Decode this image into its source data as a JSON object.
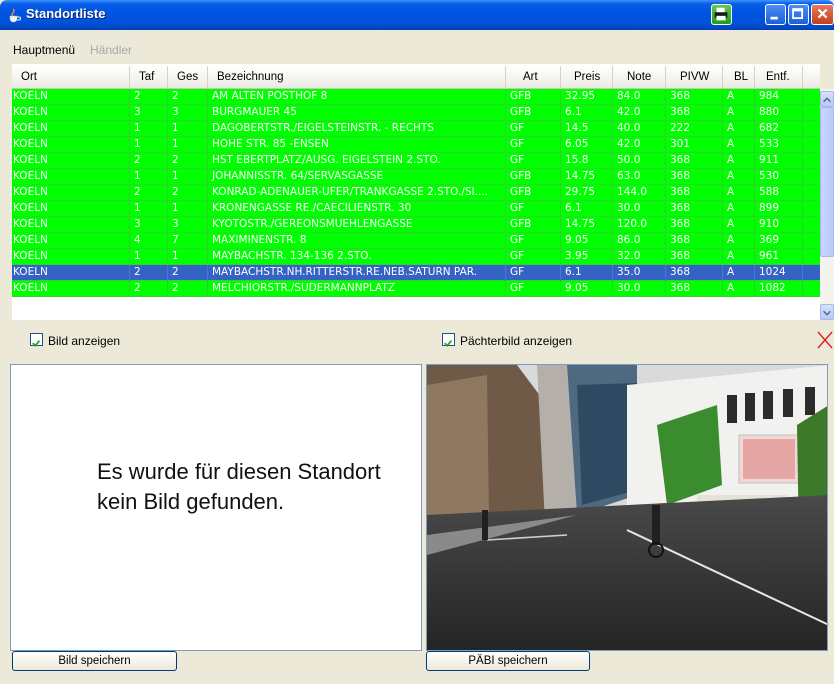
{
  "window": {
    "title": "Standortliste"
  },
  "menu": {
    "main": "Hauptmenü",
    "dealer": "Händler"
  },
  "table": {
    "columns": [
      "Ort",
      "Taf",
      "Ges",
      "Bezeichnung",
      "Art",
      "Preis",
      "Note",
      "PIVW",
      "BL",
      "Entf."
    ],
    "rows": [
      [
        "KOELN",
        "2",
        "2",
        "AM ALTEN POSTHOF 8",
        "GFB",
        "32.95",
        "84.0",
        "368",
        "A",
        "984"
      ],
      [
        "KOELN",
        "3",
        "3",
        "BURGMAUER 45",
        "GFB",
        "6.1",
        "42.0",
        "368",
        "A",
        "880"
      ],
      [
        "KOELN",
        "1",
        "1",
        "DAGOBERTSTR./EIGELSTEINSTR. - RECHTS",
        "GF",
        "14.5",
        "40.0",
        "222",
        "A",
        "682"
      ],
      [
        "KOELN",
        "1",
        "1",
        "HOHE STR. 85                    -ENSEN",
        "GF",
        "6.05",
        "42.0",
        "301",
        "A",
        "533"
      ],
      [
        "KOELN",
        "2",
        "2",
        "HST EBERTPLATZ/AUSG. EIGELSTEIN 2.STO.",
        "GF",
        "15.8",
        "50.0",
        "368",
        "A",
        "911"
      ],
      [
        "KOELN",
        "1",
        "1",
        "JOHANNISSTR. 64/SERVASGASSE",
        "GFB",
        "14.75",
        "63.0",
        "368",
        "A",
        "530"
      ],
      [
        "KOELN",
        "2",
        "2",
        "KONRAD-ADENAUER-UFER/TRANKGASSE 2.STO./SI....",
        "GFB",
        "29.75",
        "144.0",
        "368",
        "A",
        "588"
      ],
      [
        "KOELN",
        "1",
        "1",
        "KRONENGASSE RE./CAECILIENSTR. 30",
        "GF",
        "6.1",
        "30.0",
        "368",
        "A",
        "899"
      ],
      [
        "KOELN",
        "3",
        "3",
        "KYOTOSTR./GEREONSMUEHLENGASSE",
        "GFB",
        "14.75",
        "120.0",
        "368",
        "A",
        "910"
      ],
      [
        "KOELN",
        "4",
        "7",
        "MAXIMINENSTR. 8",
        "GF",
        "9.05",
        "86.0",
        "368",
        "A",
        "369"
      ],
      [
        "KOELN",
        "1",
        "1",
        "MAYBACHSTR. 134-136 2.STO.",
        "GF",
        "3.95",
        "32.0",
        "368",
        "A",
        "961"
      ],
      [
        "KOELN",
        "2",
        "2",
        "MAYBACHSTR.NH.RITTERSTR.RE.NEB.SATURN PAR.",
        "GF",
        "6.1",
        "35.0",
        "368",
        "A",
        "1024"
      ],
      [
        "KOELN",
        "2",
        "2",
        "MELCHIORSTR./SUDERMANNPLATZ",
        "GF",
        "9.05",
        "30.0",
        "368",
        "A",
        "1082"
      ]
    ],
    "selected_index": 11
  },
  "options": {
    "show_image": "Bild anzeigen",
    "show_tenant_image": "Pächterbild anzeigen"
  },
  "left_panel": {
    "message": "Es wurde für diesen Standort kein Bild gefunden."
  },
  "buttons": {
    "save_image": "Bild speichern",
    "save_tenant_image": "PÄBI speichern"
  },
  "colors": {
    "row_bg": "#00ff00",
    "selected_bg": "#3563c4",
    "row_text": "#ffffff"
  }
}
